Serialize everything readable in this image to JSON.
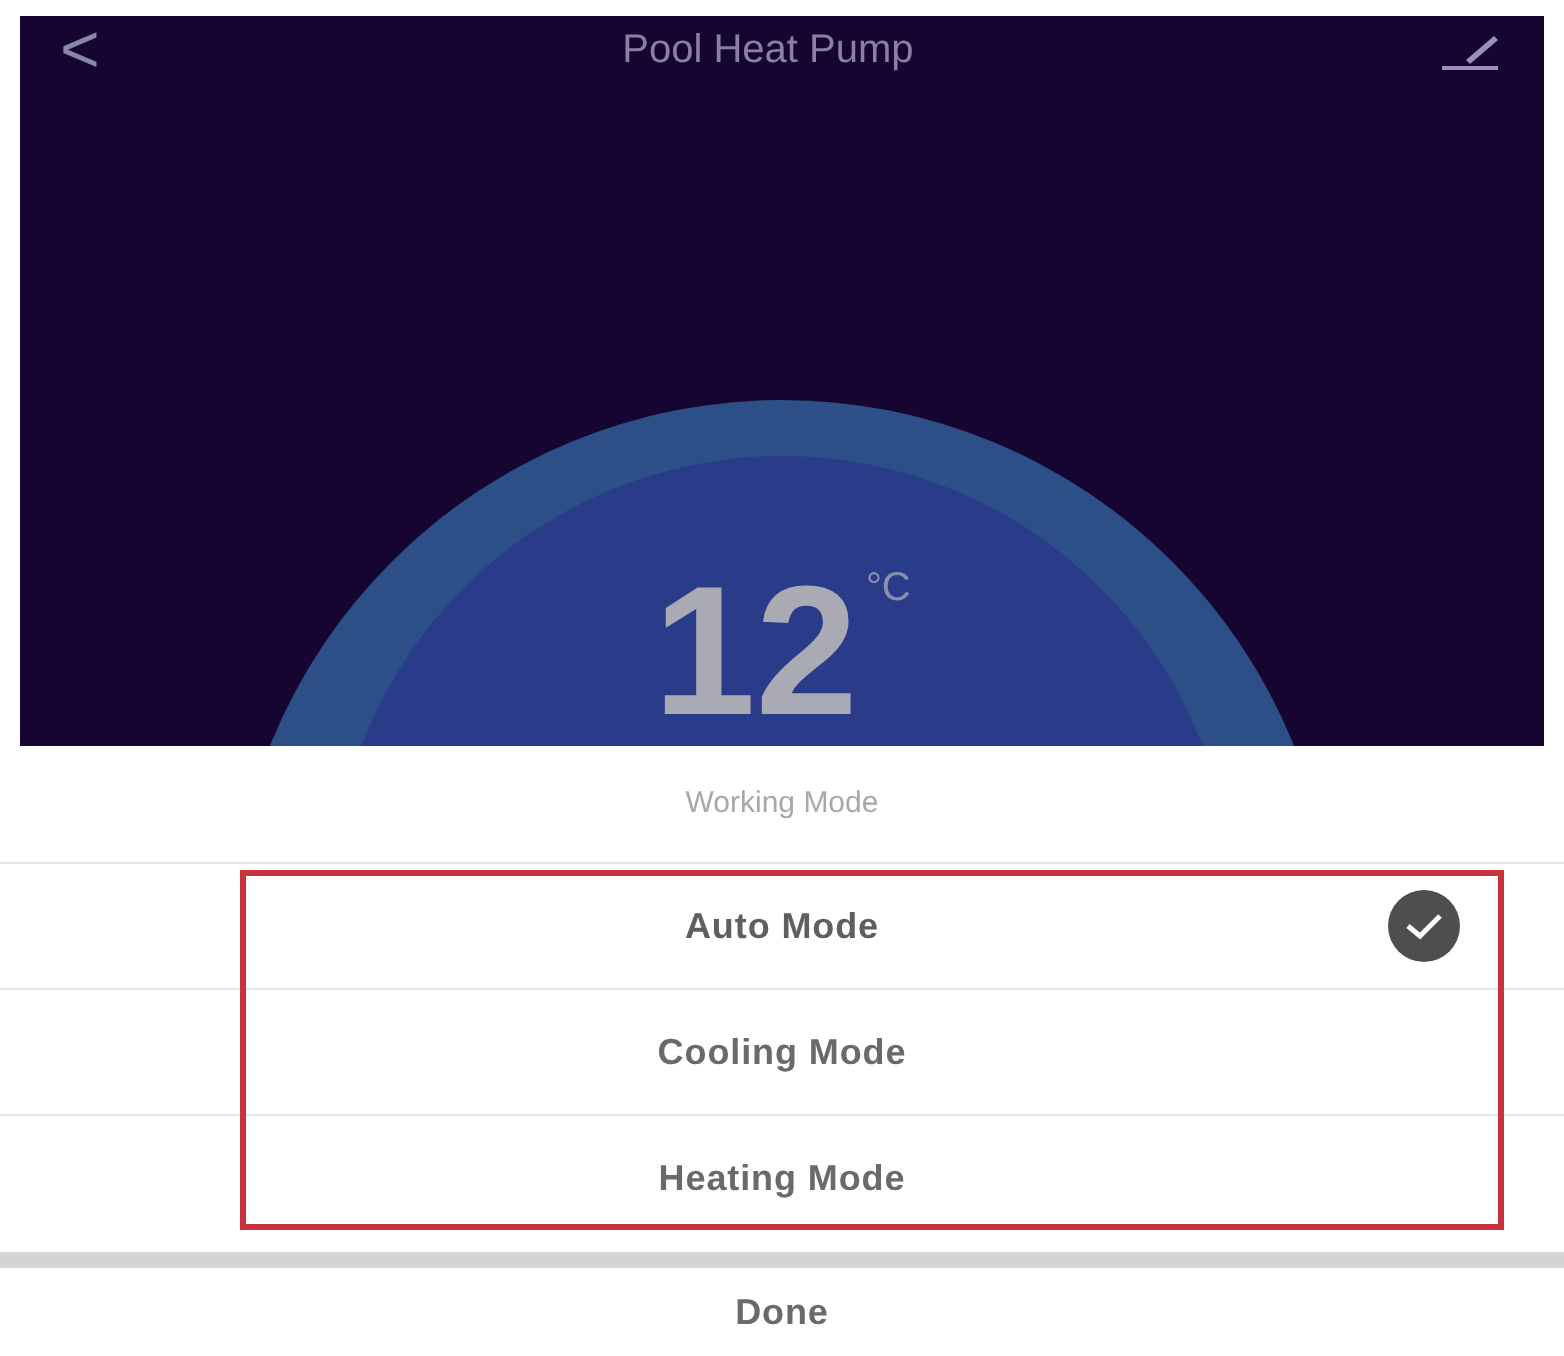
{
  "header": {
    "back": "<",
    "title": "Pool Heat Pump"
  },
  "dial": {
    "temperature": "12",
    "unit": "°C"
  },
  "sheet": {
    "title": "Working Mode",
    "options": [
      {
        "label": "Auto Mode",
        "selected": true
      },
      {
        "label": "Cooling Mode",
        "selected": false
      },
      {
        "label": "Heating Mode",
        "selected": false
      }
    ],
    "done": "Done"
  }
}
